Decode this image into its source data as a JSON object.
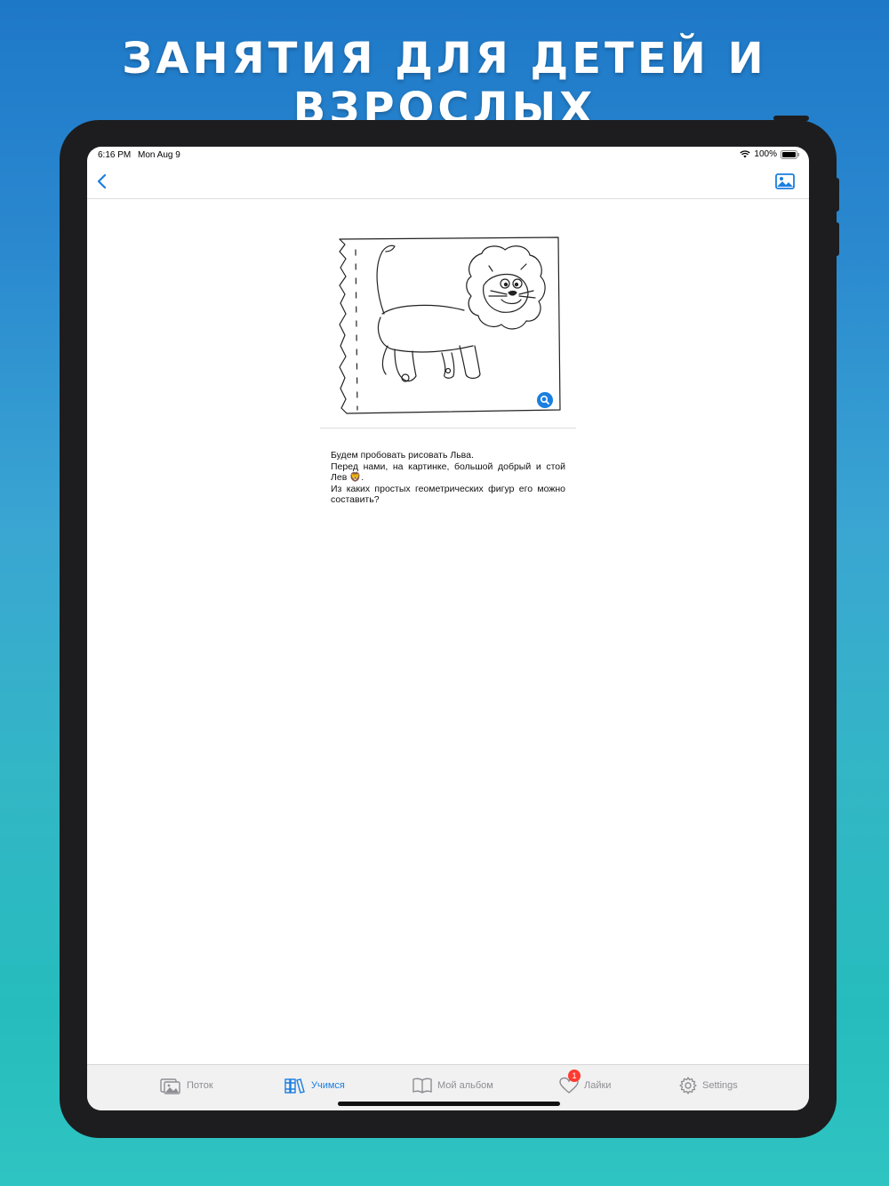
{
  "promo": {
    "headline": "ЗАНЯТИЯ ДЛЯ ДЕТЕЙ И ВЗРОСЛЫХ"
  },
  "status_bar": {
    "time": "6:16 PM",
    "date": "Mon Aug 9",
    "battery": "100%"
  },
  "nav": {
    "back_icon": "chevron-left-icon",
    "image_icon": "photo-icon"
  },
  "content": {
    "paragraphs": [
      "Будем пробовать рисовать Льва.",
      "Перед нами, на картинке, большой добрый и стой Лев 🦁.",
      "Из каких простых геометрических фигур его можно составить?"
    ]
  },
  "tabs": [
    {
      "label": "Поток",
      "icon": "photos-icon",
      "active": false
    },
    {
      "label": "Учимся",
      "icon": "books-icon",
      "active": true
    },
    {
      "label": "Мой альбом",
      "icon": "book-icon",
      "active": false
    },
    {
      "label": "Лайки",
      "icon": "heart-icon",
      "active": false,
      "badge": "1"
    },
    {
      "label": "Settings",
      "icon": "gear-icon",
      "active": false
    }
  ],
  "colors": {
    "accent": "#1a7fe0",
    "badge": "#ff3b30",
    "inactive": "#8e8e93"
  }
}
